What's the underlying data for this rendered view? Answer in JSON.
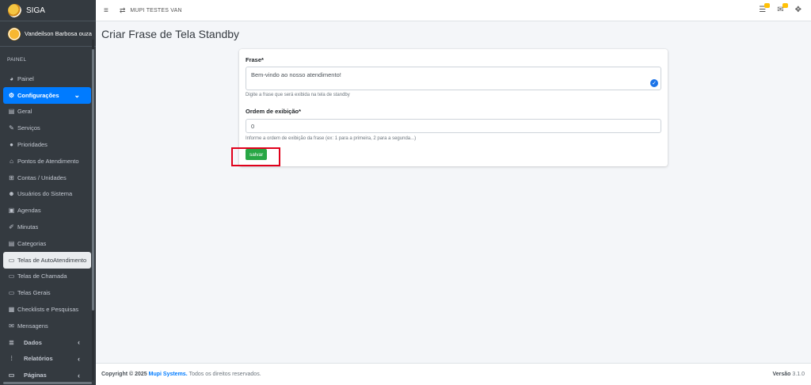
{
  "brand": {
    "name": "SIGA"
  },
  "user": {
    "name": "Vandeilson Barbosa ouza"
  },
  "sidebar": {
    "header": "PAINEL",
    "items": [
      {
        "label": "Painel",
        "icon": "tachometer-icon"
      },
      {
        "label": "Configurações",
        "icon": "gears-icon",
        "active": true,
        "chevron": "⌄"
      },
      {
        "label": "Geral",
        "icon": "print-icon"
      },
      {
        "label": "Serviços",
        "icon": "wrench-icon"
      },
      {
        "label": "Prioridades",
        "icon": "info-circle-icon"
      },
      {
        "label": "Pontos de Atendimento",
        "icon": "home-icon"
      },
      {
        "label": "Contas / Unidades",
        "icon": "sitemap-icon"
      },
      {
        "label": "Usuários do Sistema",
        "icon": "users-icon"
      },
      {
        "label": "Agendas",
        "icon": "calendar-icon"
      },
      {
        "label": "Minutas",
        "icon": "edit-icon"
      },
      {
        "label": "Categorias",
        "icon": "list-icon"
      },
      {
        "label": "Telas de AutoAtendimento",
        "icon": "desktop-icon",
        "selected": true
      },
      {
        "label": "Telas de Chamada",
        "icon": "desktop-icon"
      },
      {
        "label": "Telas Gerais",
        "icon": "desktop-icon"
      },
      {
        "label": "Checklists e Pesquisas",
        "icon": "id-card-icon"
      },
      {
        "label": "Mensagens",
        "icon": "envelope-icon"
      },
      {
        "label": "Dados",
        "icon": "database-icon",
        "chevron": "‹"
      },
      {
        "label": "Relatórios",
        "icon": "chart-icon",
        "chevron": "‹"
      },
      {
        "label": "Páginas",
        "icon": "desktop-icon",
        "chevron": "‹"
      }
    ]
  },
  "topbar": {
    "title": "MUPI TESTES VAN"
  },
  "page": {
    "title": "Criar Frase de Tela Standby"
  },
  "form": {
    "frase_label": "Frase*",
    "frase_value": "Bem-vindo ao nosso atendimento!",
    "frase_help": "Digite a frase que será exibida na tela de standby",
    "ordem_label": "Ordem de exibição*",
    "ordem_value": "0",
    "ordem_help": "Informe a ordem de exibição da frase (ex: 1 para a primeira, 2 para a segunda...)",
    "save_label": "salvar"
  },
  "footer": {
    "copyright": "Copyright © 2025",
    "company": "Mupi Systems.",
    "rights": "Todos os direitos reservados.",
    "version_label": "Versão",
    "version_value": "3.1.0"
  },
  "colors": {
    "sidebar": "#343a40",
    "accent": "#007bff",
    "success": "#28a745",
    "highlight": "#e0001b"
  }
}
